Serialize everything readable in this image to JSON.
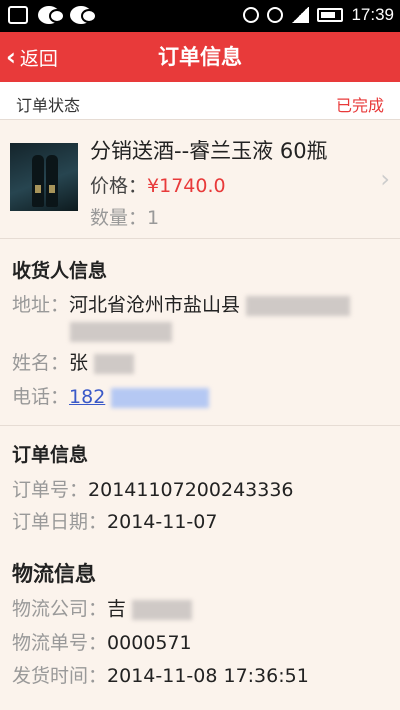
{
  "status_bar": {
    "time": "17:39"
  },
  "header": {
    "back_label": "返回",
    "title": "订单信息"
  },
  "order_status": {
    "label": "订单状态",
    "value": "已完成"
  },
  "product": {
    "name": "分销送酒--睿兰玉液 60瓶",
    "price_label": "价格：",
    "price_value": "¥1740.0",
    "quantity_label": "数量：",
    "quantity_value": "1"
  },
  "recipient": {
    "title": "收货人信息",
    "address_label": "地址：",
    "address_value": "河北省沧州市盐山县",
    "name_label": "姓名：",
    "name_value": "张",
    "phone_label": "电话：",
    "phone_value": "182"
  },
  "order_info": {
    "title": "订单信息",
    "number_label": "订单号：",
    "number_value": "20141107200243336",
    "date_label": "订单日期：",
    "date_value": "2014-11-07"
  },
  "logistics": {
    "title": "物流信息",
    "company_label": "物流公司：",
    "company_value": "吉",
    "tracking_label": "物流单号：",
    "tracking_value": "0000571",
    "ship_time_label": "发货时间：",
    "ship_time_value": "2014-11-08 17:36:51"
  },
  "colors": {
    "accent": "#e83a3a",
    "link": "#3a59c8",
    "background": "#fbf3ec"
  }
}
